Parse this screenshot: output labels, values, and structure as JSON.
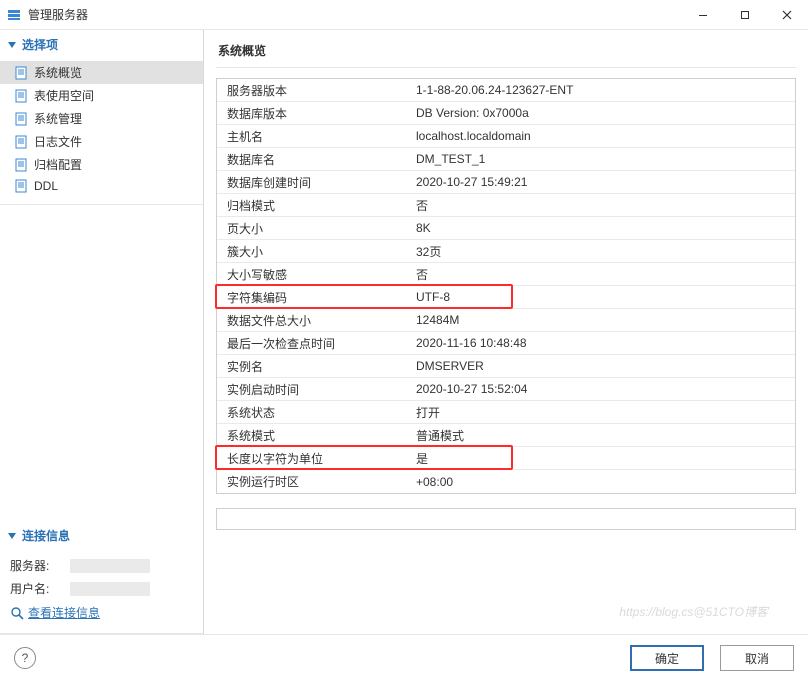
{
  "window": {
    "title": "管理服务器"
  },
  "sidebar": {
    "section_select": "选择项",
    "items": [
      {
        "label": "系统概览"
      },
      {
        "label": "表使用空间"
      },
      {
        "label": "系统管理"
      },
      {
        "label": "日志文件"
      },
      {
        "label": "归档配置"
      },
      {
        "label": "DDL"
      }
    ],
    "section_conn": "连接信息",
    "conn_server_label": "服务器:",
    "conn_user_label": "用户名:",
    "view_link": "查看连接信息"
  },
  "main": {
    "title": "系统概览",
    "rows": [
      {
        "label": "服务器版本",
        "value": "1-1-88-20.06.24-123627-ENT"
      },
      {
        "label": "数据库版本",
        "value": "DB Version: 0x7000a"
      },
      {
        "label": "主机名",
        "value": "localhost.localdomain"
      },
      {
        "label": "数据库名",
        "value": "DM_TEST_1"
      },
      {
        "label": "数据库创建时间",
        "value": "2020-10-27 15:49:21"
      },
      {
        "label": "归档模式",
        "value": "否"
      },
      {
        "label": "页大小",
        "value": "8K"
      },
      {
        "label": "簇大小",
        "value": "32页"
      },
      {
        "label": "大小写敏感",
        "value": "否"
      },
      {
        "label": "字符集编码",
        "value": "UTF-8",
        "highlight": true
      },
      {
        "label": "数据文件总大小",
        "value": "12484M"
      },
      {
        "label": "最后一次检查点时间",
        "value": "2020-11-16 10:48:48"
      },
      {
        "label": "实例名",
        "value": "DMSERVER"
      },
      {
        "label": "实例启动时间",
        "value": "2020-10-27 15:52:04"
      },
      {
        "label": "系统状态",
        "value": "打开"
      },
      {
        "label": "系统模式",
        "value": "普通模式"
      },
      {
        "label": "长度以字符为单位",
        "value": "是",
        "highlight": true
      },
      {
        "label": "实例运行时区",
        "value": "+08:00"
      }
    ]
  },
  "footer": {
    "ok": "确定",
    "cancel": "取消"
  }
}
